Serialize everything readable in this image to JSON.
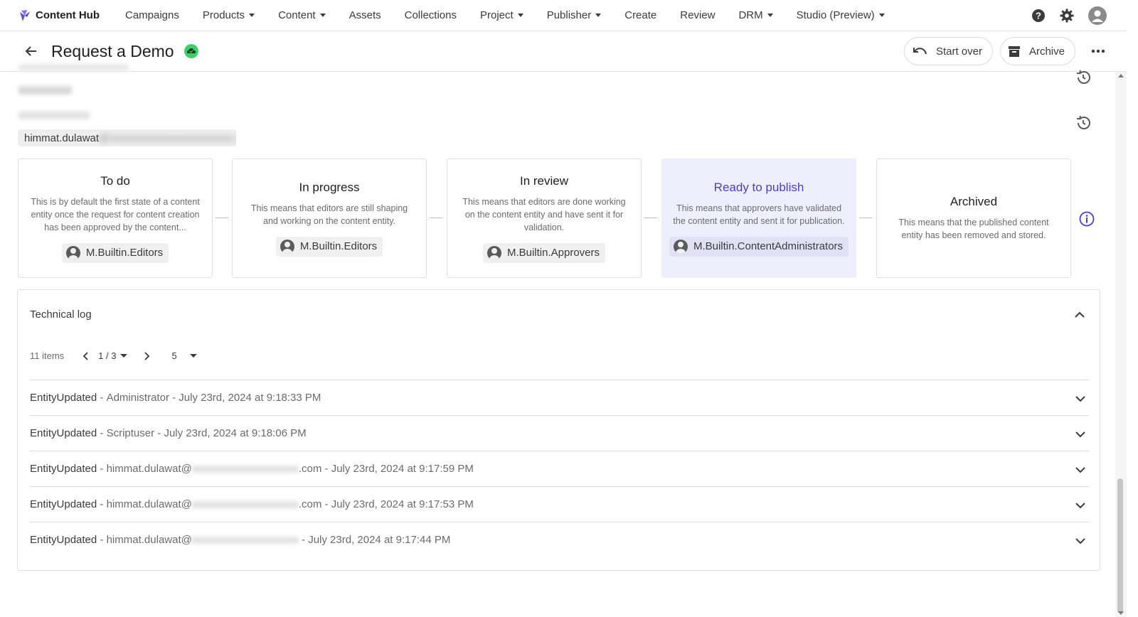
{
  "app": {
    "name": "Content Hub",
    "nav": [
      {
        "label": "Campaigns",
        "dropdown": false
      },
      {
        "label": "Products",
        "dropdown": true
      },
      {
        "label": "Content",
        "dropdown": true
      },
      {
        "label": "Assets",
        "dropdown": false
      },
      {
        "label": "Collections",
        "dropdown": false
      },
      {
        "label": "Project",
        "dropdown": true
      },
      {
        "label": "Publisher",
        "dropdown": true
      },
      {
        "label": "Create",
        "dropdown": false
      },
      {
        "label": "Review",
        "dropdown": false
      },
      {
        "label": "DRM",
        "dropdown": true
      },
      {
        "label": "Studio (Preview)",
        "dropdown": true
      }
    ],
    "icons": [
      "help-icon",
      "settings-icon",
      "user-avatar-icon"
    ]
  },
  "header": {
    "title": "Request a Demo",
    "status_icon": "cloud-check-icon",
    "buttons": {
      "start_over": "Start over",
      "archive": "Archive"
    }
  },
  "submitted": {
    "email_visible": "himmat.dulawat",
    "email_redacted": "@xxxxxxxxxxxxxxxxxxxxxxx.com"
  },
  "workflow": {
    "states": [
      {
        "title": "To do",
        "description": "This is by default the first state of a content entity once the request for content creation has been approved by the content...",
        "role": "M.Builtin.Editors",
        "active": false
      },
      {
        "title": "In progress",
        "description": "This means that editors are still shaping and working on the content entity.",
        "role": "M.Builtin.Editors",
        "active": false
      },
      {
        "title": "In review",
        "description": "This means that editors are done working on the content entity and have sent it for validation.",
        "role": "M.Builtin.Approvers",
        "active": false
      },
      {
        "title": "Ready to publish",
        "description": "This means that approvers have validated the content entity and sent it for publication.",
        "role": "M.Builtin.ContentAdministrators",
        "active": true
      },
      {
        "title": "Archived",
        "description": "This means that the published content entity has been removed and stored.",
        "role": "",
        "active": false
      }
    ],
    "accent_color": "#4a3fc4"
  },
  "technical_log": {
    "title": "Technical log",
    "item_count": "11 items",
    "page": "1 / 3",
    "page_size": "5",
    "entries": [
      {
        "event": "EntityUpdated",
        "user": "Administrator",
        "user_suffix": "",
        "redacted": false,
        "time": "July 23rd, 2024 at 9:18:33 PM"
      },
      {
        "event": "EntityUpdated",
        "user": "Scriptuser",
        "user_suffix": "",
        "redacted": false,
        "time": "July 23rd, 2024 at 9:18:06 PM"
      },
      {
        "event": "EntityUpdated",
        "user": "himmat.dulawat@",
        "user_suffix": ".com",
        "redacted": true,
        "time": "July 23rd, 2024 at 9:17:59 PM"
      },
      {
        "event": "EntityUpdated",
        "user": "himmat.dulawat@",
        "user_suffix": ".com",
        "redacted": true,
        "time": "July 23rd, 2024 at 9:17:53 PM"
      },
      {
        "event": "EntityUpdated",
        "user": "himmat.dulawat@",
        "user_suffix": "",
        "redacted": true,
        "time": "July 23rd, 2024 at 9:17:44 PM"
      }
    ]
  }
}
